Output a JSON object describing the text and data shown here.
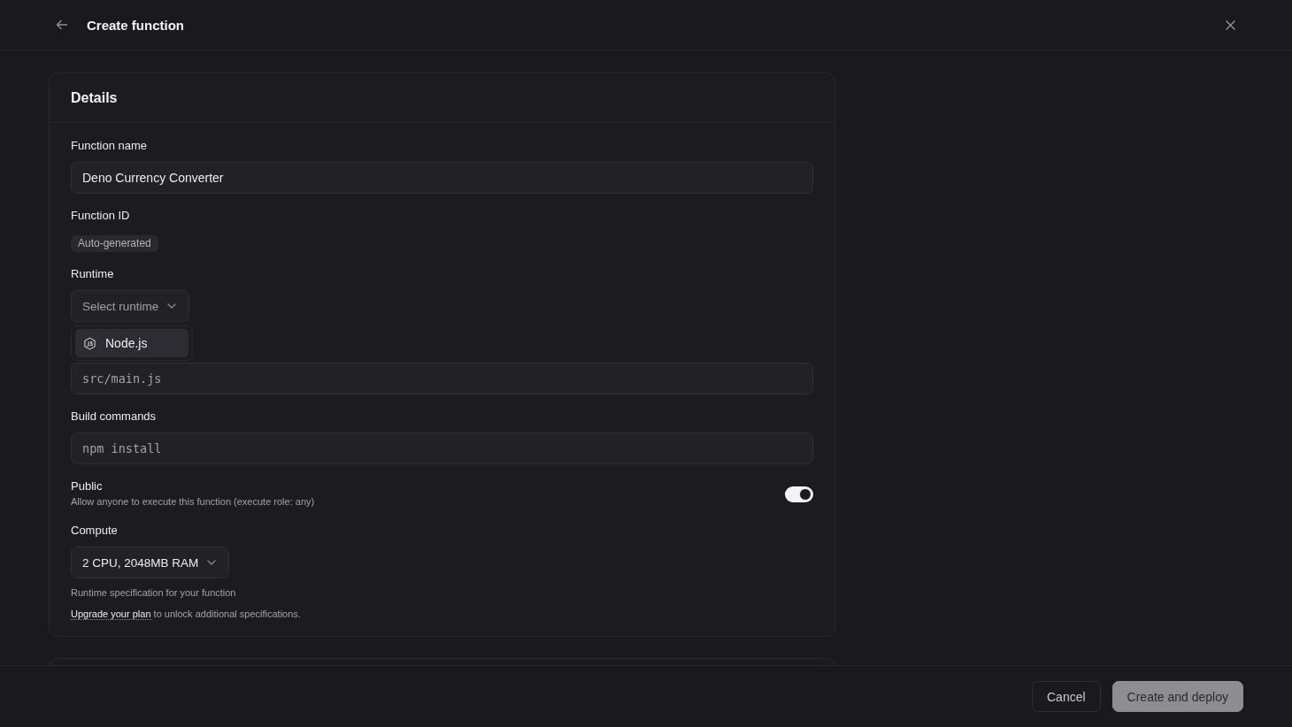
{
  "header": {
    "title": "Create function"
  },
  "details": {
    "title": "Details",
    "fields": [
      {
        "kind": "text",
        "label": "Function name",
        "value": "Deno Currency Converter"
      },
      {
        "kind": "badge",
        "label": "Function ID",
        "badge": "Auto-generated"
      },
      {
        "kind": "select",
        "label": "Runtime",
        "placeholder": "Select runtime",
        "menu": [
          {
            "label": "Node.js",
            "selected": true
          }
        ]
      },
      {
        "kind": "code",
        "placeholder": "src/main.js"
      },
      {
        "kind": "code",
        "label": "Build commands",
        "placeholder": "npm install"
      },
      {
        "kind": "toggle",
        "label": "Public",
        "description": "Allow anyone to execute this function (execute role: any)",
        "on": true
      },
      {
        "kind": "select",
        "label": "Compute",
        "value": "2 CPU, 2048MB RAM",
        "help": "Runtime specification for your function",
        "note": {
          "link": "Upgrade your plan",
          "text": "to unlock additional specifications."
        }
      }
    ]
  },
  "footer": {
    "buttons": [
      {
        "kind": "secondary",
        "label": "Cancel",
        "disabled": false
      },
      {
        "kind": "primary",
        "label": "Create and deploy",
        "disabled": true
      }
    ]
  }
}
